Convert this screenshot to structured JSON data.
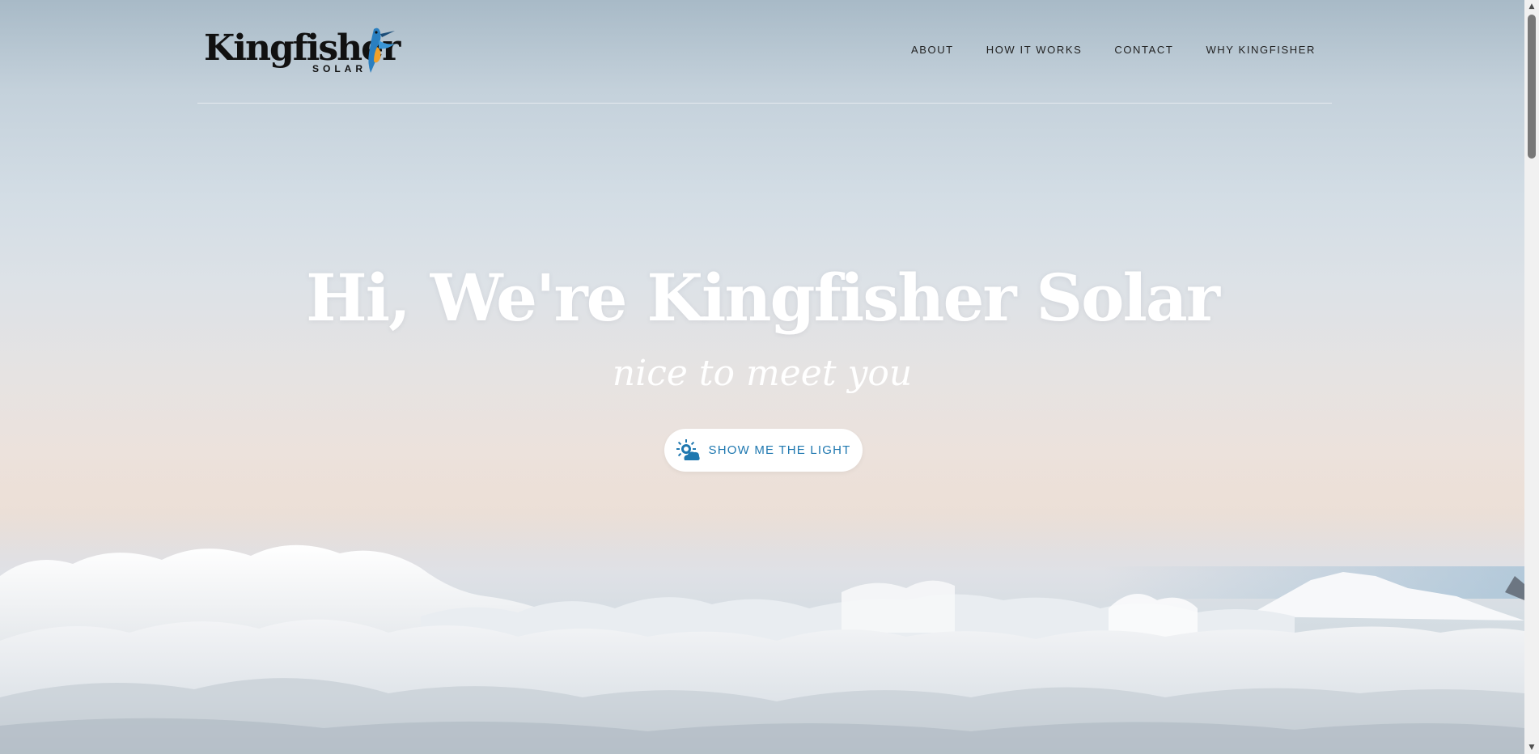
{
  "brand": {
    "name": "Kingfisher",
    "sub": "SOLAR"
  },
  "nav": {
    "items": [
      {
        "label": "ABOUT"
      },
      {
        "label": "HOW IT WORKS"
      },
      {
        "label": "CONTACT"
      },
      {
        "label": "WHY KINGFISHER"
      }
    ]
  },
  "hero": {
    "title": "Hi, We're Kingfisher Solar",
    "subtitle": "nice to meet you",
    "cta_label": "SHOW ME THE LIGHT",
    "cta_icon": "sun-cloud-icon"
  },
  "colors": {
    "accent": "#1f78b0",
    "hero_text": "#ffffff",
    "nav_text": "#222222"
  }
}
